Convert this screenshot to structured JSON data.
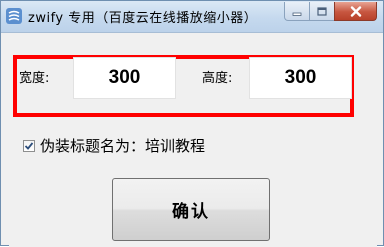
{
  "window": {
    "title": "zwify 专用（百度云在线播放缩小器）"
  },
  "titlebar_buttons": {
    "minimize": "minimize-icon",
    "maximize": "maximize-icon",
    "close": "close-icon"
  },
  "size_settings": {
    "width_label": "宽度:",
    "width_value": "300",
    "height_label": "高度:",
    "height_value": "300"
  },
  "disguise": {
    "checked": true,
    "label": "伪装标题名为：培训教程"
  },
  "confirm_button": {
    "label": "确认"
  },
  "colors": {
    "highlight_frame": "#ff0000",
    "close_button": "#c75640"
  }
}
